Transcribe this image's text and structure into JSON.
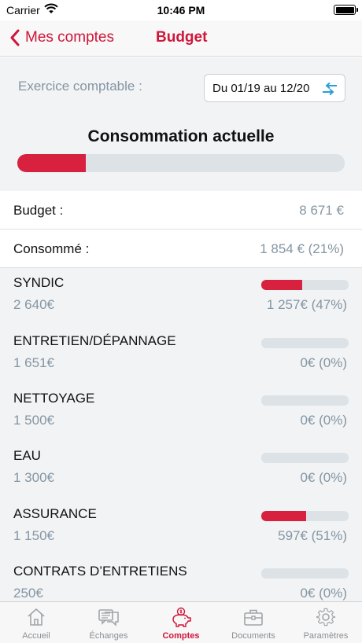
{
  "status_bar": {
    "carrier": "Carrier",
    "time": "10:46 PM"
  },
  "nav": {
    "back_label": "Mes comptes",
    "title": "Budget"
  },
  "header": {
    "fiscal_label": "Exercice comptable :",
    "period": "Du 01/19 au 12/20",
    "consumption_title": "Consommation actuelle",
    "consumption_fraction": 0.21
  },
  "summary": {
    "budget_label": "Budget :",
    "budget_value": "8 671 €",
    "consumed_label": "Consommé :",
    "consumed_value": "1 854 € (21%)"
  },
  "categories": [
    {
      "name": "SYNDIC",
      "budget": "2 640€",
      "consumed": "1 257€ (47%)",
      "fraction": 0.47
    },
    {
      "name": "ENTRETIEN/DÉPANNAGE",
      "budget": "1 651€",
      "consumed": "0€ (0%)",
      "fraction": 0
    },
    {
      "name": "NETTOYAGE",
      "budget": "1 500€",
      "consumed": "0€ (0%)",
      "fraction": 0
    },
    {
      "name": "EAU",
      "budget": "1 300€",
      "consumed": "0€ (0%)",
      "fraction": 0
    },
    {
      "name": "ASSURANCE",
      "budget": "1 150€",
      "consumed": "597€ (51%)",
      "fraction": 0.51
    },
    {
      "name": "CONTRATS D’ENTRETIENS",
      "budget": "250€",
      "consumed": "0€ (0%)",
      "fraction": 0
    }
  ],
  "tabs": [
    {
      "label": "Accueil",
      "icon": "home-icon",
      "active": false
    },
    {
      "label": "Échanges",
      "icon": "messages-icon",
      "active": false
    },
    {
      "label": "Comptes",
      "icon": "piggy-bank-icon",
      "active": true
    },
    {
      "label": "Documents",
      "icon": "briefcase-icon",
      "active": false
    },
    {
      "label": "Paramètres",
      "icon": "gear-icon",
      "active": false
    }
  ],
  "colors": {
    "accent": "#d0163a",
    "bar_fill": "#d7213e",
    "bar_track": "#dde2e6",
    "muted_text": "#8496a3"
  }
}
